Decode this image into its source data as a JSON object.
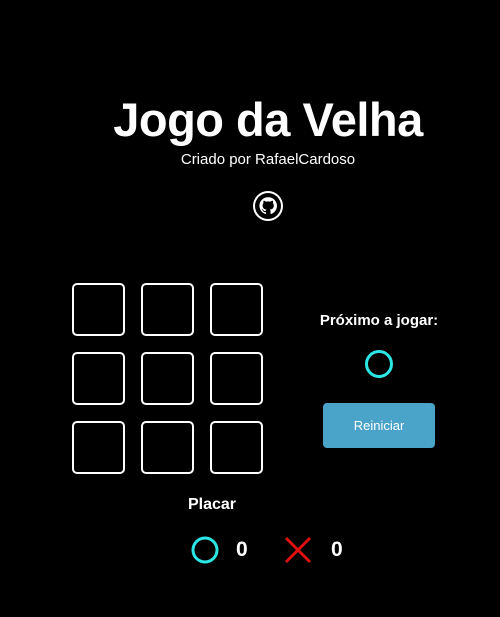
{
  "header": {
    "title": "Jogo da Velha",
    "subtitle": "Criado por RafaelCardoso",
    "link_icon": "github-icon"
  },
  "board": {
    "cells": [
      "",
      "",
      "",
      "",
      "",
      "",
      "",
      "",
      ""
    ]
  },
  "turn": {
    "label": "Próximo a jogar:",
    "current_player": "O",
    "marker_icon": "circle-o-icon"
  },
  "controls": {
    "restart_label": "Reiniciar"
  },
  "scoreboard": {
    "label": "Placar",
    "o_score": "0",
    "x_score": "0",
    "o_icon": "circle-o-icon",
    "x_icon": "cross-x-icon"
  },
  "colors": {
    "background": "#000000",
    "text": "#ffffff",
    "o_color": "#2ce6e6",
    "x_color": "#e01010",
    "button": "#4aa3c8"
  }
}
